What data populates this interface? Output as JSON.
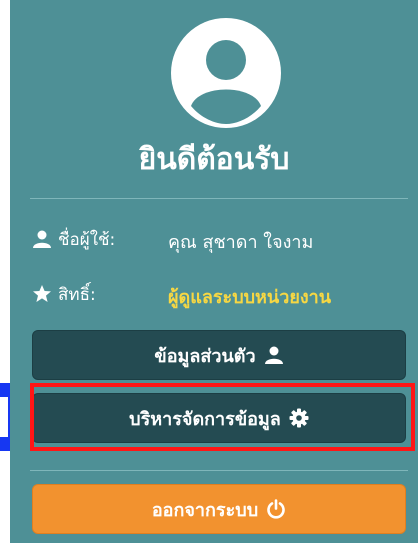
{
  "profile": {
    "avatar_icon": "user-avatar-icon",
    "welcome_text": "ยินดีต้อนรับ"
  },
  "info": {
    "user_label": "ชื่อผู้ใช้:",
    "user_value": "คุณ สุชาดา ใจงาม",
    "user_icon": "user-icon",
    "rights_label": "สิทธิ์:",
    "rights_value": "ผู้ดูแลระบบหน่วยงาน",
    "rights_icon": "star-icon"
  },
  "buttons": {
    "personal_info": "ข้อมูลส่วนตัว",
    "personal_info_icon": "user-icon",
    "manage_data": "บริหารจัดการข้อมูล",
    "manage_data_icon": "gear-icon",
    "logout": "ออกจากระบบ",
    "logout_icon": "power-icon"
  },
  "colors": {
    "panel": "#4e9096",
    "dark_button": "#244b52",
    "orange_button": "#f2922f",
    "rights_text": "#f6d743",
    "highlight_border": "#ff1616",
    "side_marker": "#1637f2"
  }
}
